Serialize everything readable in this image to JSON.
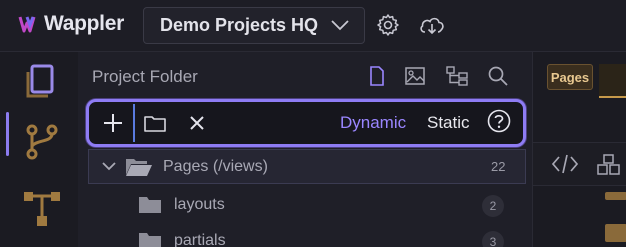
{
  "app": {
    "name": "Wappler",
    "project": "Demo Projects HQ"
  },
  "panel": {
    "title": "Project Folder",
    "toolbar": {
      "dynamic_label": "Dynamic",
      "static_label": "Static"
    },
    "tree": [
      {
        "label": "Pages (/views)",
        "count": "22",
        "expanded": true
      },
      {
        "label": "layouts",
        "count": "2"
      },
      {
        "label": "partials",
        "count": "3"
      }
    ]
  },
  "right": {
    "tab_label": "Pages"
  },
  "colors": {
    "accent": "#8e7cf4",
    "dynamic": "#9a86ff",
    "folder": "#a9a9b5",
    "pages_tab": "#e8c890"
  },
  "icons": [
    "settings-icon",
    "cloud-download-icon",
    "files-icon",
    "git-icon",
    "flow-icon",
    "file-icon",
    "image-icon",
    "tree-icon",
    "search-icon",
    "plus-icon",
    "folder-icon",
    "close-icon",
    "help-icon",
    "code-icon",
    "components-icon"
  ]
}
